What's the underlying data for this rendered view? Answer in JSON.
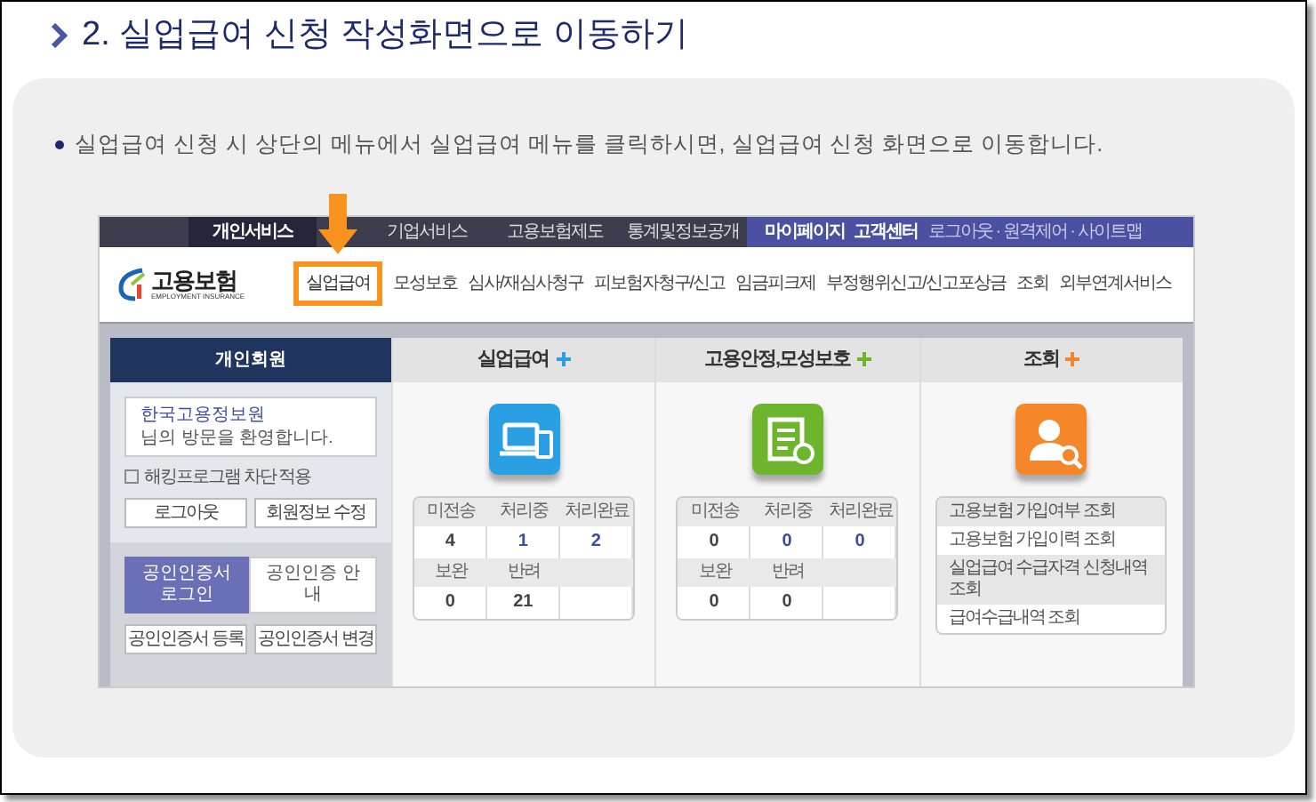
{
  "heading": "2. 실업급여 신청 작성화면으로 이동하기",
  "instruction": "실업급여 신청 시 상단의 메뉴에서 실업급여 메뉴를 클릭하시면, 실업급여 신청 화면으로 이동합니다.",
  "site": {
    "top_menu": [
      {
        "label": "개인서비스",
        "selected": true
      },
      {
        "label": "기업서비스",
        "selected": false
      },
      {
        "label": "고용보험제도",
        "selected": false
      },
      {
        "label": "통계및정보공개",
        "selected": false
      }
    ],
    "utility_links": [
      "마이페이지",
      "고객센터"
    ],
    "utility_small": "로그아웃 · 원격제어 · 사이트맵",
    "logo": {
      "name": "고용보험",
      "subtitle": "EMPLOYMENT INSURANCE"
    },
    "main_menu": [
      {
        "label": "실업급여",
        "highlighted": true
      },
      {
        "label": "모성보호",
        "highlighted": false
      },
      {
        "label": "심사/재심사청구",
        "highlighted": false
      },
      {
        "label": "피보험자청구/신고",
        "highlighted": false
      },
      {
        "label": "임금피크제",
        "highlighted": false
      },
      {
        "label": "부정행위신고/신고포상금",
        "highlighted": false
      },
      {
        "label": "조회",
        "highlighted": false
      },
      {
        "label": "외부연계서비스",
        "highlighted": false
      }
    ],
    "member_panel": {
      "title": "개인회원",
      "org": "한국고용정보원",
      "welcome": "님의 방문을 환영합니다.",
      "security_option": {
        "label": "해킹프로그램 차단 적용",
        "checked": false
      },
      "buttons": [
        "로그아웃",
        "회원정보 수정"
      ],
      "cert_tabs": [
        {
          "label": "공인인증서 로그인",
          "selected": true
        },
        {
          "label": "공인인증 안내",
          "selected": false
        }
      ],
      "cert_buttons": [
        "공인인증서 등록",
        "공인인증서 변경"
      ]
    },
    "services": [
      {
        "kind": "counts",
        "title": "실업급여",
        "color": "#2b9fe3",
        "stats": [
          {
            "label": "미전송",
            "value": "4"
          },
          {
            "label": "처리중",
            "value": "1"
          },
          {
            "label": "처리완료",
            "value": "2"
          },
          {
            "label": "보완",
            "value": "0"
          },
          {
            "label": "반려",
            "value": "21"
          }
        ]
      },
      {
        "kind": "counts",
        "title": "고용안정,모성보호",
        "color": "#6cb52d",
        "stats": [
          {
            "label": "미전송",
            "value": "0"
          },
          {
            "label": "처리중",
            "value": "0"
          },
          {
            "label": "처리완료",
            "value": "0"
          },
          {
            "label": "보완",
            "value": "0"
          },
          {
            "label": "반려",
            "value": "0"
          }
        ]
      },
      {
        "kind": "links",
        "title": "조회",
        "color": "#f5862a",
        "links": [
          "고용보험 가입여부 조회",
          "고용보험 가입이력 조회",
          "실업급여 수급자격 신청내역 조회",
          "급여수급내역 조회"
        ]
      }
    ]
  }
}
